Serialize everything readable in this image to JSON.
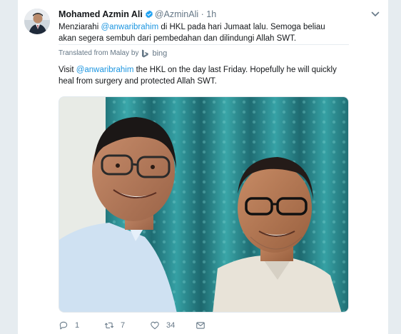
{
  "tweet": {
    "author_name": "Mohamed Azmin Ali",
    "handle": "@AzminAli",
    "separator": "·",
    "time": "1h",
    "original": {
      "line1_before": "Menziarahi ",
      "mention": "@anwaribrahim",
      "line1_after": " di HKL pada hari Jumaat lalu. Semoga beliau akan segera sembuh dari pembedahan dan dilindungi Allah SWT."
    },
    "translated_label": "Translated from Malay by",
    "translator_name": "bing",
    "translation": {
      "before": "Visit ",
      "mention": "@anwaribrahim",
      "after": " the HKL on the day last Friday. Hopefully he will quickly heal from surgery and protected Allah SWT."
    },
    "stats": {
      "replies": "1",
      "retweets": "7",
      "likes": "34"
    }
  },
  "colors": {
    "link": "#1b95e0",
    "muted": "#657786",
    "verified": "#1da1f2",
    "curtain": "#2b8d93"
  },
  "icons": [
    "verified-badge-icon",
    "caret-down-icon",
    "bing-logo-icon",
    "reply-icon",
    "retweet-icon",
    "like-icon",
    "direct-message-icon"
  ]
}
